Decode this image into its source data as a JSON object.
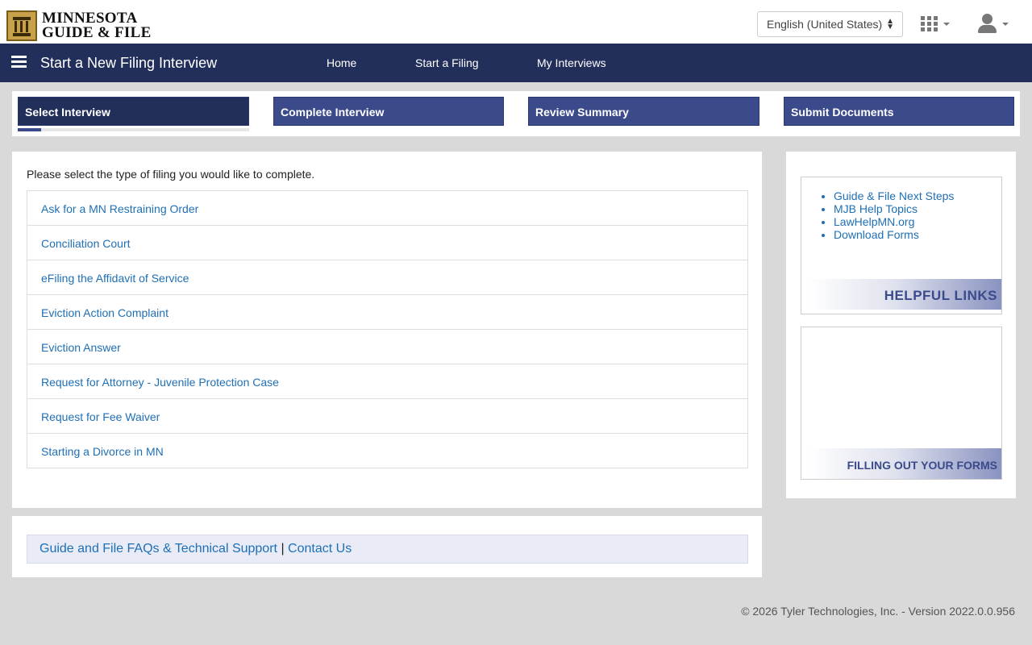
{
  "header": {
    "logo_line1": "MINNESOTA",
    "logo_line2": "GUIDE & FILE",
    "language": "English (United States)"
  },
  "navbar": {
    "title": "Start a New Filing Interview",
    "links": [
      "Home",
      "Start a Filing",
      "My Interviews"
    ]
  },
  "steps": {
    "items": [
      "Select Interview",
      "Complete Interview",
      "Review Summary",
      "Submit Documents"
    ],
    "active_index": 0,
    "progress_fraction": 0.1
  },
  "main": {
    "prompt": "Please select the type of filing you would like to complete.",
    "filings": [
      "Ask for a MN Restraining Order",
      "Conciliation Court",
      "eFiling the Affidavit of Service",
      "Eviction Action Complaint",
      "Eviction Answer",
      "Request for Attorney - Juvenile Protection Case",
      "Request for Fee Waiver",
      "Starting a Divorce in MN"
    ]
  },
  "footer": {
    "faq_link": "Guide and File FAQs & Technical Support",
    "separator": "|",
    "contact_link": "Contact Us"
  },
  "sidebar": {
    "links": [
      "Guide & File Next Steps",
      "MJB Help Topics",
      "LawHelpMN.org",
      "Download Forms"
    ],
    "helpful_links_title": "HELPFUL LINKS",
    "forms_title": "FILLING OUT YOUR FORMS"
  },
  "copyright": "© 2026 Tyler Technologies, Inc. - Version 2022.0.0.956",
  "colors": {
    "navbar": "#232f5b",
    "step": "#3b4a8b",
    "link": "#1f6fb5",
    "background": "#d9d9d9"
  },
  "icons": [
    "pillar-logo-icon",
    "select-caret-icon",
    "apps-grid-icon",
    "user-icon",
    "hamburger-icon"
  ]
}
